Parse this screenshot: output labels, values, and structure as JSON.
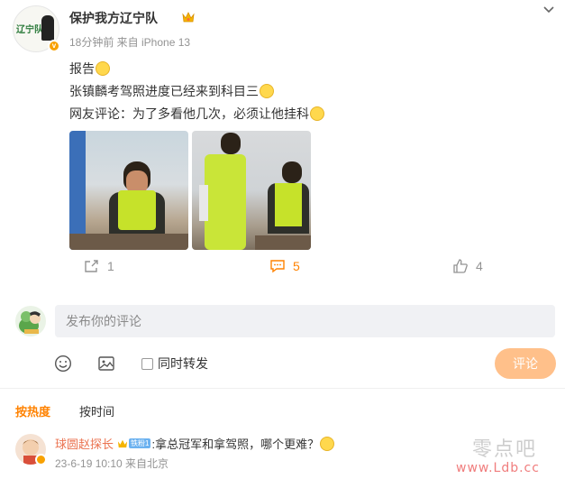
{
  "post": {
    "author": "保护我方辽宁队",
    "avatar_text": "辽宁队",
    "meta": "18分钟前  来自 iPhone 13",
    "lines": [
      "报告",
      "张镇麟考驾照进度已经来到科目三",
      "网友评论：为了多看他几次，必须让他挂科"
    ],
    "photos": [
      "photo-1",
      "photo-2"
    ]
  },
  "actions": {
    "share_count": "1",
    "comment_count": "5",
    "like_count": "4"
  },
  "composer": {
    "placeholder": "发布你的评论",
    "repost_label": "同时转发",
    "submit_label": "评论"
  },
  "sort_tabs": {
    "hot": "按热度",
    "time": "按时间"
  },
  "comment": {
    "user": "球圆赵探长",
    "fan_level": "铁粉1",
    "text": ":拿总冠军和拿驾照，哪个更难？",
    "meta": "23-6-19 10:10 来自北京"
  },
  "watermark": {
    "text": "零点吧",
    "url": "www.Ldb.cc"
  },
  "colors": {
    "accent": "#ff8200",
    "username_link": "#eb7350",
    "submit_disabled": "#ffc08a",
    "meta_gray": "#939393"
  }
}
